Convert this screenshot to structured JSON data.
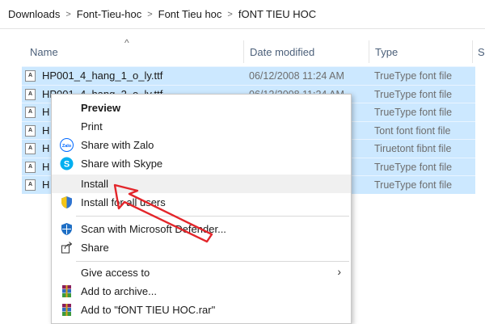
{
  "breadcrumb": {
    "items": [
      "Downloads",
      "Font-Tieu-hoc",
      "Font Tieu hoc",
      "fONT TIEU HOC"
    ],
    "separator": ">"
  },
  "columns": {
    "name": "Name",
    "date_modified": "Date modified",
    "type": "Type",
    "size": "S",
    "sort_indicator": "^"
  },
  "files": [
    {
      "name": "HP001_4_hang_1_o_ly.ttf",
      "date": "06/12/2008 11:24 AM",
      "type": "TrueType font file"
    },
    {
      "name": "HP001_4_hang_2_o_ly.ttf",
      "date": "06/12/2008 11:24 AM",
      "type": "TrueType font file"
    },
    {
      "name": "H",
      "date": "",
      "type": "TrueType font file"
    },
    {
      "name": "H",
      "date": "",
      "type": "Tont font fiont file"
    },
    {
      "name": "H",
      "date": "",
      "type": "Tiruetont fibnt file"
    },
    {
      "name": "H",
      "date": "",
      "type": "TrueType font file"
    },
    {
      "name": "H",
      "date": "",
      "type": "TrueType font file"
    }
  ],
  "file_icon_glyph": "A",
  "context_menu": {
    "preview": "Preview",
    "print": "Print",
    "share_zalo": "Share with Zalo",
    "share_skype": "Share with Skype",
    "install": "Install",
    "install_all_users": "Install for all users",
    "scan_defender": "Scan with Microsoft Defender...",
    "share": "Share",
    "give_access": "Give access to",
    "add_archive": "Add to archive...",
    "add_rar": "Add to \"fONT TIEU HOC.rar\"",
    "zalo_icon_text": "Zalo",
    "skype_icon_text": "S",
    "submenu_arrow": "›"
  },
  "colors": {
    "selection": "#cce8ff",
    "annotation_arrow": "#e3262b"
  },
  "icons": [
    "zalo-icon",
    "skype-icon",
    "shield-icon",
    "defender-icon",
    "share-icon",
    "winrar-icon"
  ]
}
